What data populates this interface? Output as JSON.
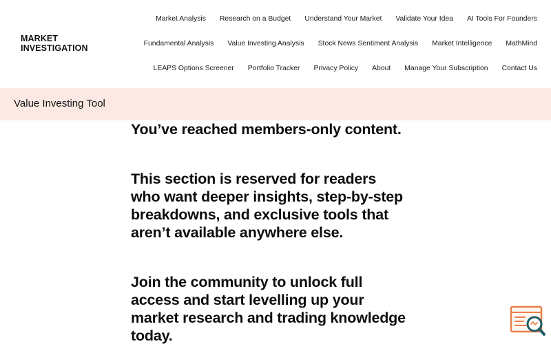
{
  "site": {
    "logo_line1": "MARKET",
    "logo_line2": "INVESTIGATION"
  },
  "nav": {
    "row1": [
      "Market Analysis",
      "Research on a Budget",
      "Understand Your Market",
      "Validate Your Idea",
      "AI Tools For Founders"
    ],
    "row2": [
      "Fundamental Analysis",
      "Value Investing Analysis",
      "Stock News Sentiment Analysis",
      "Market Intelligence",
      "MathMind"
    ],
    "row3": [
      "LEAPS Options Screener",
      "Portfolio Tracker",
      "Privacy Policy",
      "About",
      "Manage Your Subscription",
      "Contact Us"
    ]
  },
  "page": {
    "title": "Value Investing Tool"
  },
  "content": {
    "paragraphs": [
      "You’ve reached members-only content.",
      "This section is reserved for readers who want deeper insights, step-by-step breakdowns, and exclusive tools that aren’t available anywhere else.",
      "Join the community to unlock full access and start levelling up your market research and trading knowledge today."
    ]
  },
  "colors": {
    "banner_bg": "#fce9e4",
    "text": "#111111",
    "widget_orange": "#e8804a",
    "widget_teal": "#1f5c63"
  },
  "icons": {
    "widget": "search-document-icon"
  }
}
